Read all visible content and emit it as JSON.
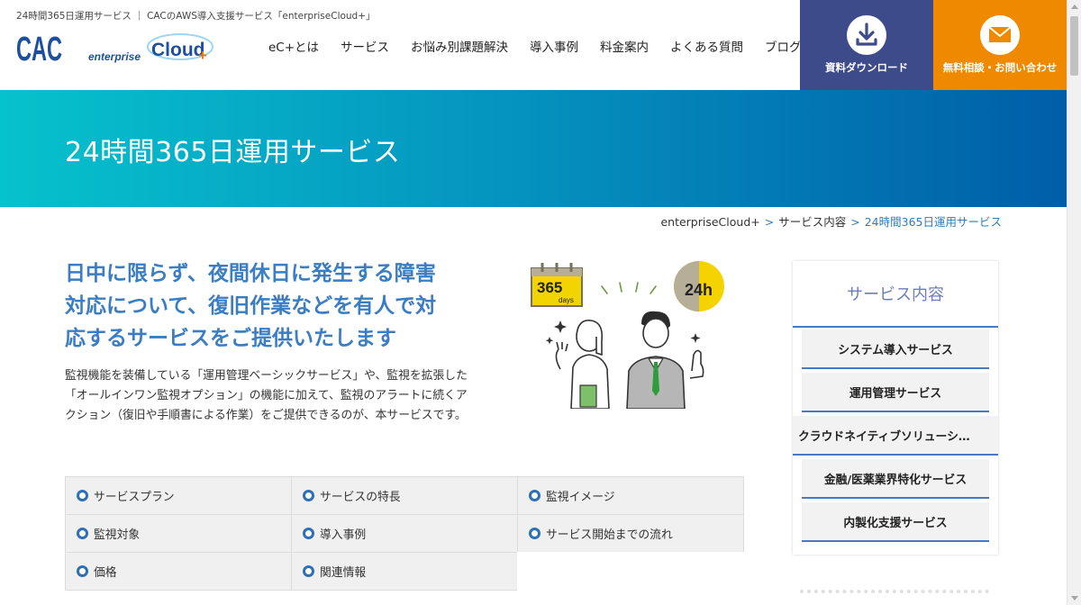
{
  "header": {
    "tagline": "24時間365日運用サービス ｜ CACのAWS導入支援サービス「enterpriseCloud+」",
    "logo_cac_text": "CAC",
    "logo_ec_prefix": "enterprise",
    "logo_ec_main": "Cloud",
    "logo_ec_plus": "+",
    "nav": [
      "eC+とは",
      "サービス",
      "お悩み別課題解決",
      "導入事例",
      "料金案内",
      "よくある質問",
      "ブログ"
    ],
    "cta_download": {
      "label": "資料ダウンロード",
      "icon": "download-icon",
      "color": "#3e4b8a"
    },
    "cta_contact": {
      "label": "無料相談・お問い合わせ",
      "icon": "mail-icon",
      "color": "#ef8a00"
    }
  },
  "hero": {
    "title": "24時間365日運用サービス"
  },
  "breadcrumb": {
    "items": [
      "enterpriseCloud+",
      "サービス内容"
    ],
    "current": "24時間365日運用サービス",
    "separator": ">"
  },
  "main": {
    "headline_lines": [
      "日中に限らず、夜間休日に発生する障害",
      "対応について、復旧作業などを有人で対",
      "応するサービスをご提供いたします"
    ],
    "intro": "監視機能を装備している「運用管理ベーシックサービス」や、監視を拡張した「オールインワン監視オプション」の機能に加えて、監視のアラートに続くアクション（復旧や手順書による作業）をご提供できるのが、本サービスです。",
    "illustration": {
      "calendar_number": "365",
      "calendar_caption": "days",
      "clock_label": "24h"
    },
    "links": [
      [
        "サービスプラン",
        "サービスの特長",
        "監視イメージ"
      ],
      [
        "監視対象",
        "導入事例",
        "サービス開始までの流れ"
      ],
      [
        "価格",
        "関連情報",
        ""
      ]
    ]
  },
  "sidebar": {
    "title": "サービス内容",
    "items": [
      "システム導入サービス",
      "運用管理サービス",
      "クラウドネイティブソリューシ…",
      "金融/医薬業界特化サービス",
      "内製化支援サービス"
    ]
  },
  "colors": {
    "accent": "#3a7dc3",
    "hero_start": "#06c2cc",
    "hero_end": "#005ea8",
    "link_dot": "#2d6fb6"
  }
}
